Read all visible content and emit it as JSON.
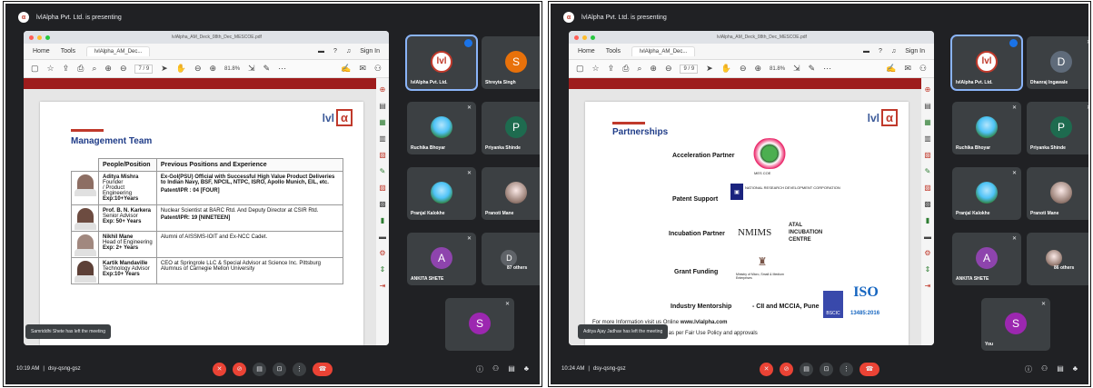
{
  "left": {
    "presenting": "lvlAlpha Pvt. Ltd. is presenting",
    "file_tab": "lvlAlpha_AM_Deck_08th_Dec_MESCOE.pdf",
    "nav": {
      "home": "Home",
      "tools": "Tools",
      "doc_tab": "lvlAlpha_AM_Dec...",
      "sign_in": "Sign In"
    },
    "page_num": "7 / 9",
    "zoom": "81.8%",
    "slide": {
      "logo_text": "lvl",
      "logo_mark": "α",
      "title": "Management Team",
      "headers": [
        "People/Position",
        "Previous Positions and Experience"
      ],
      "rows": [
        {
          "name": "Aditya Mishra",
          "role": "Founder\n/ Product Engineering",
          "exp": "Exp:10+Years",
          "desc_bold": "Ex-GoI(PSU) Official with Successful High Value Product Deliveries to Indian Navy, BSF, NPCIL, NTPC, ISRO, Apollo Munich, EIL, etc.",
          "desc_extra": "Patent/IPR : 04 [FOUR]"
        },
        {
          "name": "Prof. B. N. Karkera",
          "role": "Senior Advisor",
          "exp": "Exp: 50+ Years",
          "desc_bold": "",
          "desc_plain": "Nuclear Scientist at BARC Rtd. And Deputy Director at CSIR Rtd.",
          "desc_extra": "Patent/IPR: 19 [NINETEEN]"
        },
        {
          "name": "Nikhil Mane",
          "role": "Head of Engineering",
          "exp": "Exp: 2+ Years",
          "desc_bold": "",
          "desc_plain": "Alumni of AISSMS-IOIT and Ex-NCC Cadet.",
          "desc_extra": ""
        },
        {
          "name": "Kartik Mandaville",
          "role": "Technology Advisor",
          "exp": "Exp:10+ Years",
          "desc_bold": "",
          "desc_plain": "CEO at Springrole LLC & Special Advisor at Science Inc. Pittsburg\nAlumnus of Carnegie Mellon University",
          "desc_extra": ""
        }
      ]
    },
    "participants": [
      {
        "name": "lvlAlpha Pvt. Ltd.",
        "initial": "lvl",
        "kind": "logo"
      },
      {
        "name": "Shreyta Singh",
        "initial": "S",
        "color": "#e8710a"
      },
      {
        "name": "Ruchika Bhoyar",
        "initial": "",
        "kind": "photo"
      },
      {
        "name": "Priyanka Shinde",
        "initial": "P",
        "color": "#1e6b4f"
      },
      {
        "name": "Pranjal Kalokhe",
        "initial": "",
        "kind": "photo"
      },
      {
        "name": "Pranoti Mane",
        "initial": "",
        "kind": "photo2"
      },
      {
        "name": "ANKITA SHETE",
        "initial": "A",
        "color": "#8e44ad"
      },
      {
        "name": "87 others",
        "initial": "D",
        "color": "#5f6368"
      },
      {
        "name": "",
        "initial": "S",
        "color": "#9c27b0"
      }
    ],
    "toast": "Samriddhi Shete has left the meeting",
    "time": "10:19 AM",
    "code": "dsy-qsng-gsz"
  },
  "right": {
    "presenting": "lvlAlpha Pvt. Ltd. is presenting",
    "file_tab": "lvlAlpha_AM_Deck_08th_Dec_MESCOE.pdf",
    "nav": {
      "home": "Home",
      "tools": "Tools",
      "doc_tab": "lvlAlpha_AM_Dec...",
      "sign_in": "Sign In"
    },
    "page_num": "9 / 9",
    "zoom": "81.8%",
    "slide": {
      "logo_text": "lvl",
      "logo_mark": "α",
      "title": "Partnerships",
      "rows": [
        {
          "label": "Acceleration Partner",
          "partner": "MES COE"
        },
        {
          "label": "Patent Support",
          "partner": "NATIONAL RESEARCH DEVELOPMENT CORPORATION"
        },
        {
          "label": "Incubation Partner",
          "partner": "NMIMS",
          "partner2": "ATAL INCUBATION CENTRE"
        },
        {
          "label": "Grant Funding",
          "partner": "Ministry of Micro, Small & Medium Enterprises"
        },
        {
          "label": "Industry Mentorship",
          "partner": "- CII and MCCIA, Pune"
        }
      ],
      "iso": "ISO",
      "iso_num": "13485:2016",
      "bscic": "BSCIC",
      "more_info": "For more Information visit us Online",
      "site": "www.lvlalpha.com",
      "fair_use": "ormation used as per Fair Use Policy and approvals"
    },
    "participants": [
      {
        "name": "lvlAlpha Pvt. Ltd.",
        "initial": "lvl",
        "kind": "logo"
      },
      {
        "name": "Dhanraj Ingawale",
        "initial": "D",
        "color": "#5f6b7a"
      },
      {
        "name": "Ruchika Bhoyar",
        "initial": "",
        "kind": "photo"
      },
      {
        "name": "Priyanka Shinde",
        "initial": "P",
        "color": "#1e6b4f"
      },
      {
        "name": "Pranjal Kalokhe",
        "initial": "",
        "kind": "photo"
      },
      {
        "name": "Pranoti Mane",
        "initial": "",
        "kind": "photo2"
      },
      {
        "name": "ANKITA SHETE",
        "initial": "A",
        "color": "#8e44ad"
      },
      {
        "name": "86 others",
        "initial": "",
        "kind": "photo2"
      },
      {
        "name": "You",
        "initial": "S",
        "color": "#9c27b0"
      }
    ],
    "toast": "Aditya Ajay Jadhav has left the meeting",
    "time": "10:24 AM",
    "code": "dsy-qsng-gsz"
  },
  "you_label": "You"
}
